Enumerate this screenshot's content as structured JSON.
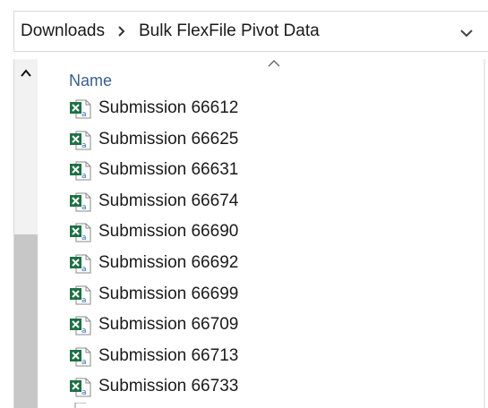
{
  "breadcrumb": {
    "items": [
      "Downloads",
      "Bulk FlexFile Pivot Data"
    ],
    "separator_icon": "chevron-right-icon",
    "dropdown_icon": "chevron-down-icon"
  },
  "file_list": {
    "column_header": "Name",
    "sort_icon": "chevron-up-icon",
    "file_icon": "excel-file-icon",
    "files": [
      "Submission 66612",
      "Submission 66625",
      "Submission 66631",
      "Submission 66674",
      "Submission 66690",
      "Submission 66692",
      "Submission 66699",
      "Submission 66709",
      "Submission 66713",
      "Submission 66733"
    ]
  },
  "colors": {
    "excel_green": "#1e7145",
    "header_text": "#3a5f8a",
    "scrollbar_thumb": "#c7c7c7"
  }
}
